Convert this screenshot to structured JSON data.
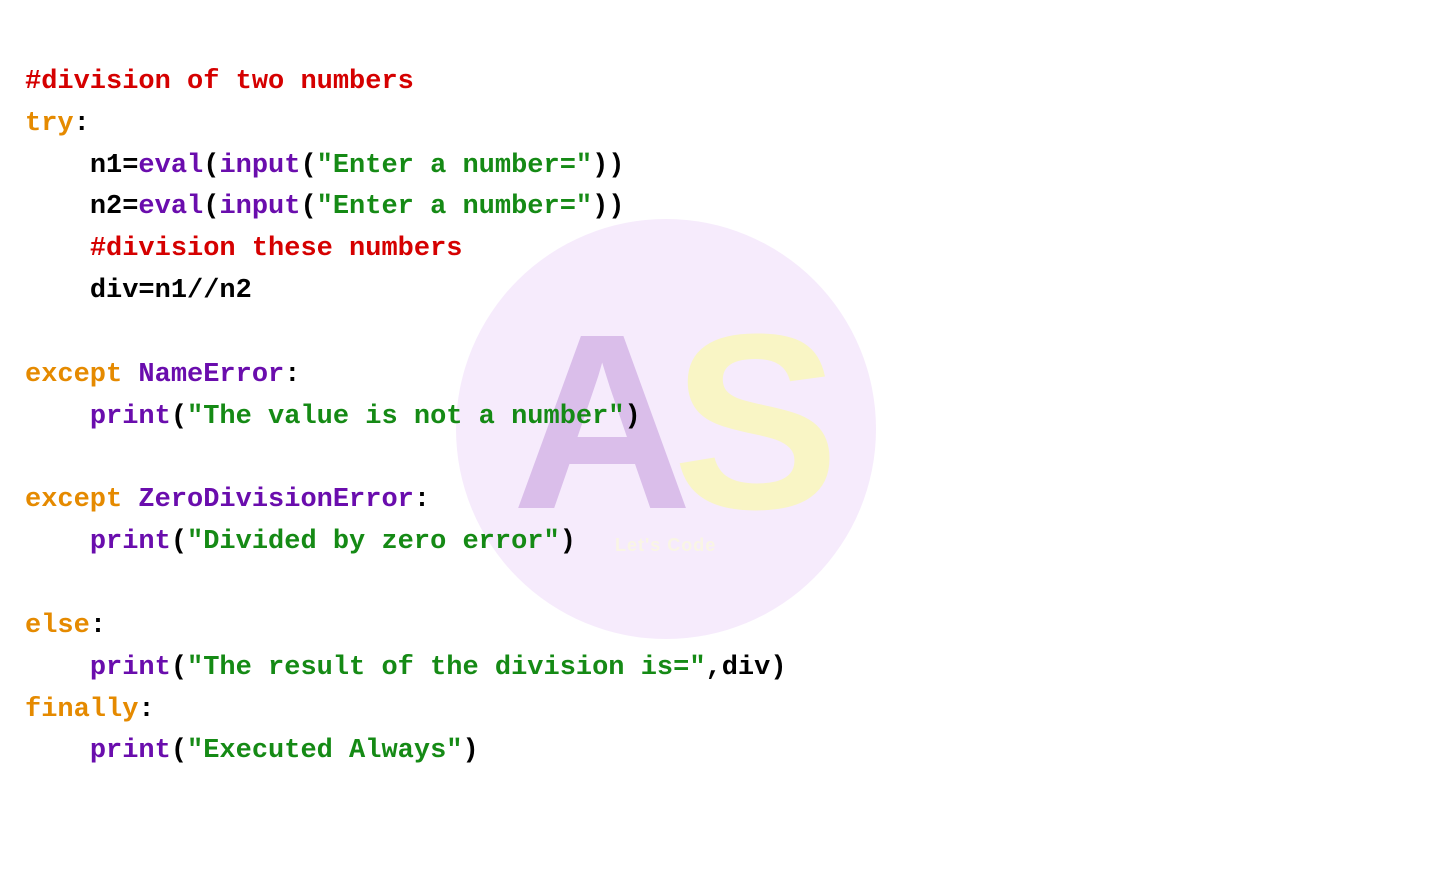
{
  "watermark": {
    "a": "A",
    "s": "S",
    "tag": "Let's Code"
  },
  "code": {
    "l1": {
      "comment": "#division of two numbers"
    },
    "l2": {
      "kw": "try",
      "colon": ":"
    },
    "l3": {
      "indent": "    ",
      "var": "n1=",
      "eval": "eval",
      "p1": "(",
      "input": "input",
      "p2": "(",
      "str": "\"Enter a number=\"",
      "p3": "))"
    },
    "l4": {
      "indent": "    ",
      "var": "n2=",
      "eval": "eval",
      "p1": "(",
      "input": "input",
      "p2": "(",
      "str": "\"Enter a number=\"",
      "p3": "))"
    },
    "l5": {
      "indent": "    ",
      "comment": "#division these numbers"
    },
    "l6": {
      "indent": "    ",
      "text": "div=n1//n2"
    },
    "l7": {
      "blank": ""
    },
    "l8": {
      "kw": "except",
      "sp": " ",
      "err": "NameError",
      "colon": ":"
    },
    "l9": {
      "indent": "    ",
      "print": "print",
      "p1": "(",
      "str": "\"The value is not a number\"",
      "p2": ")"
    },
    "l10": {
      "blank": ""
    },
    "l11": {
      "kw": "except",
      "sp": " ",
      "err": "ZeroDivisionError",
      "colon": ":"
    },
    "l12": {
      "indent": "    ",
      "print": "print",
      "p1": "(",
      "str": "\"Divided by zero error\"",
      "p2": ")"
    },
    "l13": {
      "blank": ""
    },
    "l14": {
      "kw": "else",
      "colon": ":"
    },
    "l15": {
      "indent": "    ",
      "print": "print",
      "p1": "(",
      "str": "\"The result of the division is=\"",
      "comma": ",div)"
    },
    "l16": {
      "kw": "finally",
      "colon": ":"
    },
    "l17": {
      "indent": "    ",
      "print": "print",
      "p1": "(",
      "str": "\"Executed Always\"",
      "p2": ")"
    }
  }
}
